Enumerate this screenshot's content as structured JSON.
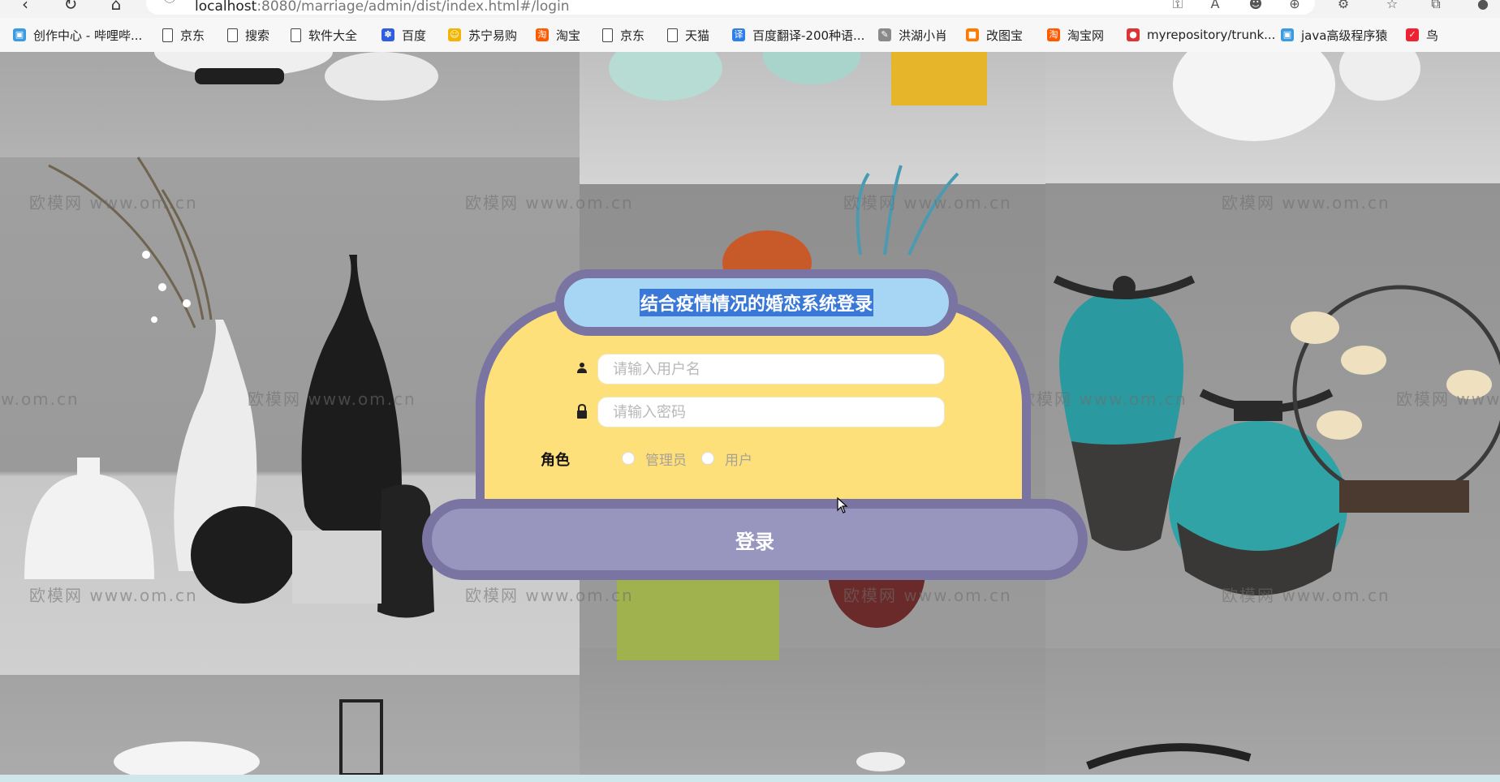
{
  "browser": {
    "url_host": "localhost",
    "url_rest": ":8080/marriage/admin/dist/index.html#/login",
    "bookmarks": [
      {
        "label": "创作中心 - 哔哩哔...",
        "icon": "bilibili-icon"
      },
      {
        "label": "京东",
        "icon": "page-icon"
      },
      {
        "label": "搜索",
        "icon": "page-icon"
      },
      {
        "label": "软件大全",
        "icon": "page-icon"
      },
      {
        "label": "百度",
        "icon": "baidu-icon"
      },
      {
        "label": "苏宁易购",
        "icon": "suning-icon"
      },
      {
        "label": "淘宝",
        "icon": "taobao-icon"
      },
      {
        "label": "京东",
        "icon": "page-icon"
      },
      {
        "label": "天猫",
        "icon": "page-icon"
      },
      {
        "label": "百度翻译-200种语...",
        "icon": "baidu-translate-icon"
      },
      {
        "label": "洪湖小肖",
        "icon": "feather-icon"
      },
      {
        "label": "改图宝",
        "icon": "gaitubao-icon"
      },
      {
        "label": "淘宝网",
        "icon": "taobao-icon"
      },
      {
        "label": "myrepository/trunk...",
        "icon": "chrome-icon"
      },
      {
        "label": "java高级程序猿",
        "icon": "bilibili-icon"
      },
      {
        "label": "鸟",
        "icon": "bird-icon"
      }
    ]
  },
  "background": {
    "watermark": "欧模网 www.om.cn"
  },
  "login": {
    "title": "结合疫情情况的婚恋系统登录",
    "username_placeholder": "请输入用户名",
    "password_placeholder": "请输入密码",
    "role_label": "角色",
    "roles": [
      "管理员",
      "用户"
    ],
    "submit_label": "登录"
  },
  "colors": {
    "card_fill": "#fee07b",
    "card_border": "#7a74a2",
    "title_fill": "#a7d6f5",
    "button_fill": "#9896be"
  }
}
